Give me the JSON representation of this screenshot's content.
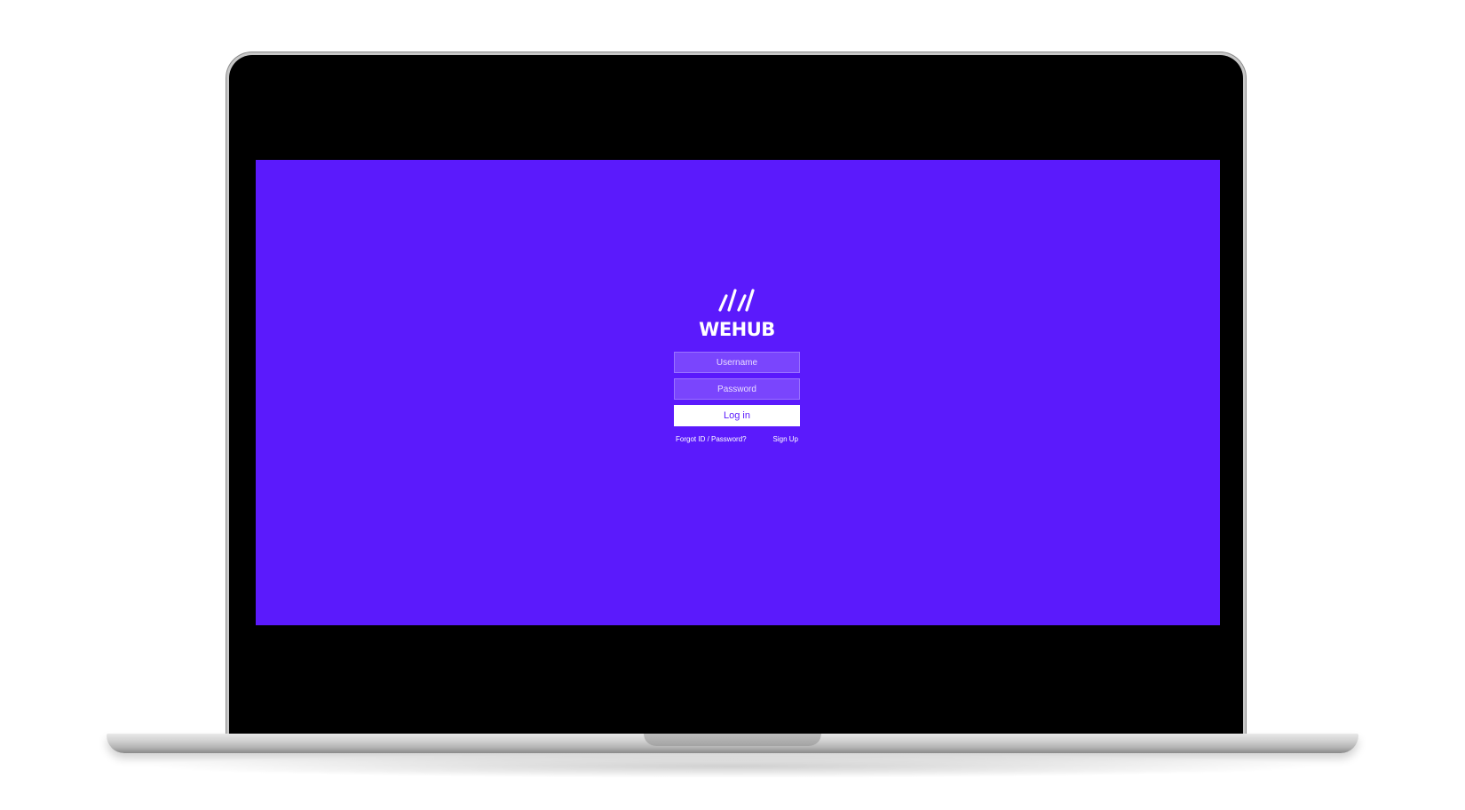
{
  "colors": {
    "screen_background": "#5b1afc",
    "field_background": "#7a45fd",
    "button_background": "#ffffff",
    "button_text": "#5b1afc",
    "text": "#ffffff"
  },
  "logo": {
    "icon": "wehub-slashes-logo-icon",
    "name": "WEHUB"
  },
  "login_form": {
    "username_placeholder": "Username",
    "password_placeholder": "Password",
    "login_label": "Log in",
    "forgot_link": "Forgot ID / Password?",
    "signup_link": "Sign Up"
  }
}
